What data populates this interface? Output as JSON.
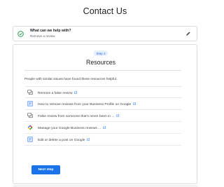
{
  "page": {
    "title": "Contact Us"
  },
  "step1": {
    "question": "What can we help with?",
    "answer": "Remove a review",
    "status_icon": "check-circle-icon",
    "edit_icon": "pencil-icon",
    "accent_color": "#1e8e3e"
  },
  "step2": {
    "badge": "Step 2",
    "heading": "Resources",
    "intro": "People with similar issues have found these resources helpful.",
    "resources": [
      {
        "label": "Remove a false review",
        "icon": "chat-bubble-icon"
      },
      {
        "label": "How to remove reviews from your Business Profile on Google",
        "icon": "article-icon"
      },
      {
        "label": "False review from someone that's never been in ...",
        "icon": "chat-bubble-icon"
      },
      {
        "label": "Manage your Google Business reviews ...",
        "icon": "google-business-icon"
      },
      {
        "label": "Edit or delete a post on Google",
        "icon": "article-icon"
      }
    ],
    "next_button": "Next step",
    "button_color": "#1a73e8"
  }
}
